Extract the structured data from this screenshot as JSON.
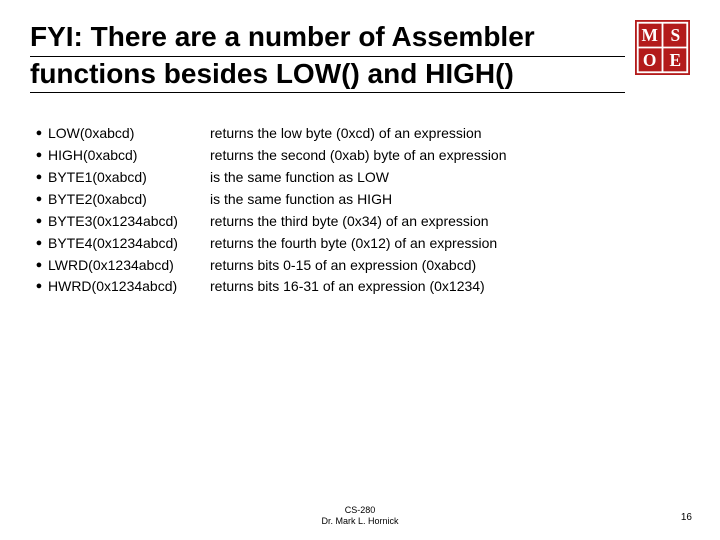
{
  "title_line_pre": "FYI: There are a number of Assembler",
  "title_line_post": "functions besides LOW() and HIGH()",
  "items": [
    {
      "fn": "LOW(0xabcd)",
      "desc": "returns the low byte (0xcd) of an expression"
    },
    {
      "fn": "HIGH(0xabcd)",
      "desc": "returns the second (0xab) byte of an expression"
    },
    {
      "fn": "BYTE1(0xabcd)",
      "desc": "is the same function as LOW"
    },
    {
      "fn": "BYTE2(0xabcd)",
      "desc": "is the same function as HIGH"
    },
    {
      "fn": "BYTE3(0x1234abcd)",
      "desc": "returns the third byte (0x34) of an expression"
    },
    {
      "fn": "BYTE4(0x1234abcd)",
      "desc": "returns the fourth byte (0x12) of an expression"
    },
    {
      "fn": "LWRD(0x1234abcd)",
      "desc": "returns bits 0-15 of an expression (0xabcd)"
    },
    {
      "fn": "HWRD(0x1234abcd)",
      "desc": "returns bits 16-31 of an expression (0x1234)"
    }
  ],
  "footer_course": "CS-280",
  "footer_author": "Dr. Mark L. Hornick",
  "page_number": "16",
  "logo": {
    "bg": "#b31b1b",
    "fg": "#ffffff",
    "text_top": "MS",
    "text_bottom": "OE"
  }
}
